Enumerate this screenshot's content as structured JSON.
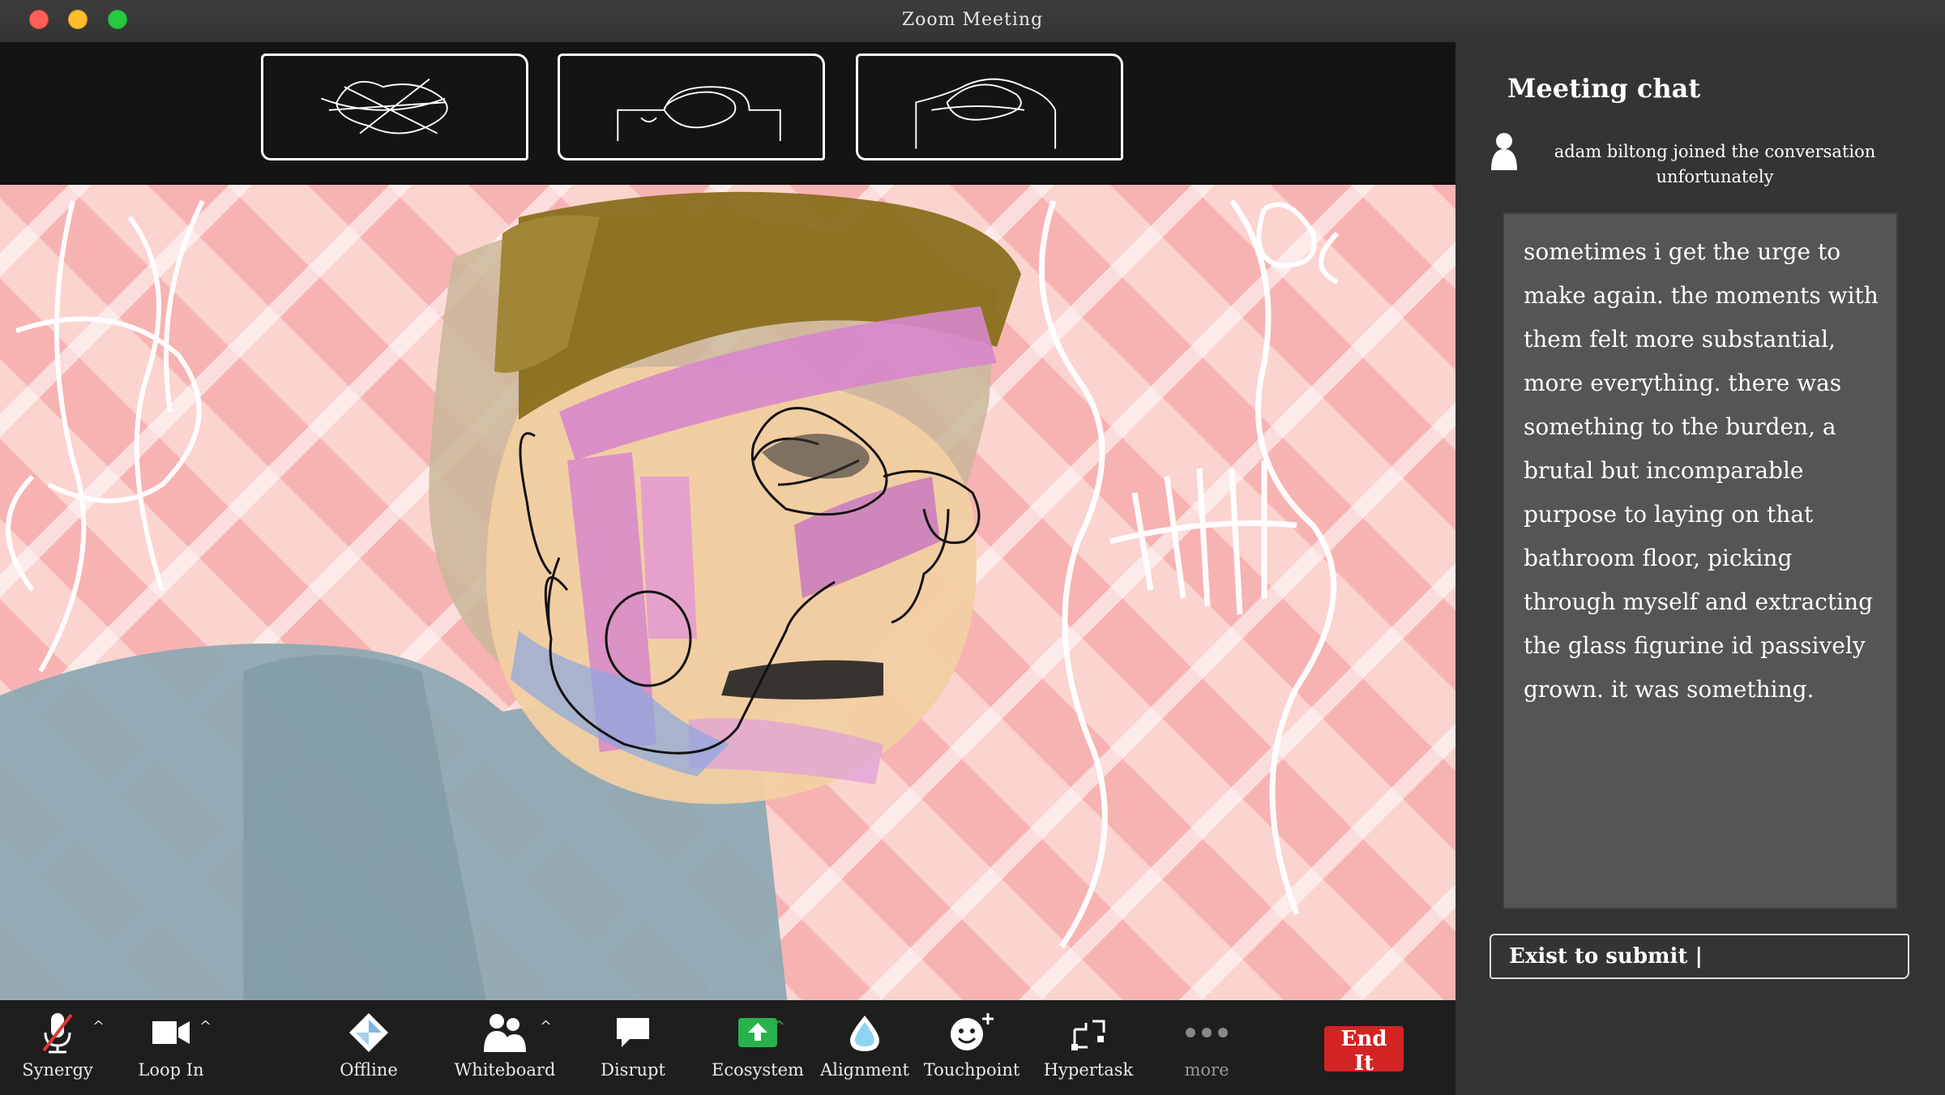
{
  "window": {
    "title": "Zoom Meeting"
  },
  "chat": {
    "title": "Meeting chat",
    "join_line_1": "adam biltong  joined the conversation",
    "join_line_2": "unfortunately",
    "message": "sometimes i get the urge to make again. the moments with them felt more substantial, more everything. there was something to the burden, a brutal but incomparable purpose to laying on that bathroom floor, picking through myself and extracting the glass figurine id passively grown. it was something.",
    "input_value": "Exist to submit |"
  },
  "toolbar": {
    "synergy": "Synergy",
    "loop_in": "Loop In",
    "offline": "Offline",
    "whiteboard": "Whiteboard",
    "disrupt": "Disrupt",
    "ecosystem": "Ecosystem",
    "alignment": "Alignment",
    "touchpoint": "Touchpoint",
    "hypertask": "Hypertask",
    "more": "more",
    "end": "End It"
  },
  "colors": {
    "end_button": "#d42323",
    "ecosystem_icon": "#28b24b",
    "alignment_icon": "#8fd3f4"
  },
  "icons": {
    "synergy": "microphone-muted-icon",
    "loop_in": "video-camera-icon",
    "offline": "share-diamond-icon",
    "whiteboard": "participants-icon",
    "disrupt": "chat-bubble-icon",
    "ecosystem": "share-screen-icon",
    "alignment": "drop-icon",
    "touchpoint": "smiley-plus-icon",
    "hypertask": "apps-icon",
    "more": "ellipsis-icon"
  }
}
